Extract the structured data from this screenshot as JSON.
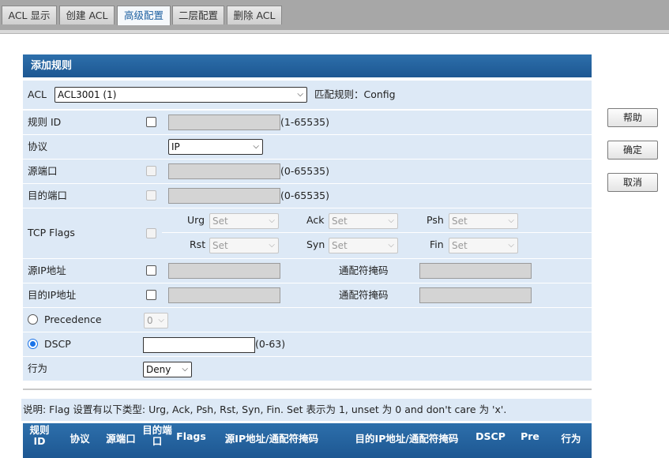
{
  "tabs": [
    {
      "label": "ACL 显示",
      "active": false
    },
    {
      "label": "创建 ACL",
      "active": false
    },
    {
      "label": "高级配置",
      "active": true
    },
    {
      "label": "二层配置",
      "active": false
    },
    {
      "label": "删除 ACL",
      "active": false
    }
  ],
  "panel": {
    "title": "添加规则",
    "acl_label": "ACL",
    "acl_selected": "ACL3001 (1)",
    "match_rule": "匹配规则：Config",
    "rule_id_label": "规则 ID",
    "rule_id_range": "(1-65535)",
    "protocol_label": "协议",
    "protocol_selected": "IP",
    "src_port_label": "源端口",
    "src_port_range": "(0-65535)",
    "dst_port_label": "目的端口",
    "dst_port_range": "(0-65535)",
    "tcp_flags_label": "TCP Flags",
    "flags": {
      "urg": {
        "label": "Urg",
        "value": "Set"
      },
      "ack": {
        "label": "Ack",
        "value": "Set"
      },
      "psh": {
        "label": "Psh",
        "value": "Set"
      },
      "rst": {
        "label": "Rst",
        "value": "Set"
      },
      "syn": {
        "label": "Syn",
        "value": "Set"
      },
      "fin": {
        "label": "Fin",
        "value": "Set"
      }
    },
    "src_ip_label": "源IP地址",
    "dst_ip_label": "目的IP地址",
    "wildcard_label": "通配符掩码",
    "precedence_label": "Precedence",
    "precedence_value": "0",
    "dscp_label": "DSCP",
    "dscp_value": "",
    "dscp_range": "(0-63)",
    "action_label": "行为",
    "action_selected": "Deny"
  },
  "buttons": {
    "help": "帮助",
    "ok": "确定",
    "cancel": "取消"
  },
  "note": "说明: Flag 设置有以下类型: Urg, Ack, Psh, Rst, Syn, Fin. Set 表示为 1, unset 为 0 and don't care 为 'x'.",
  "table_headers": {
    "rule_id": "规则 ID",
    "protocol": "协议",
    "src_port": "源端口",
    "dst_port": "目的端口",
    "flags": "Flags",
    "src_ip": "源IP地址/通配符掩码",
    "dst_ip": "目的IP地址/通配符掩码",
    "dscp": "DSCP",
    "pre": "Pre",
    "action": "行为"
  }
}
